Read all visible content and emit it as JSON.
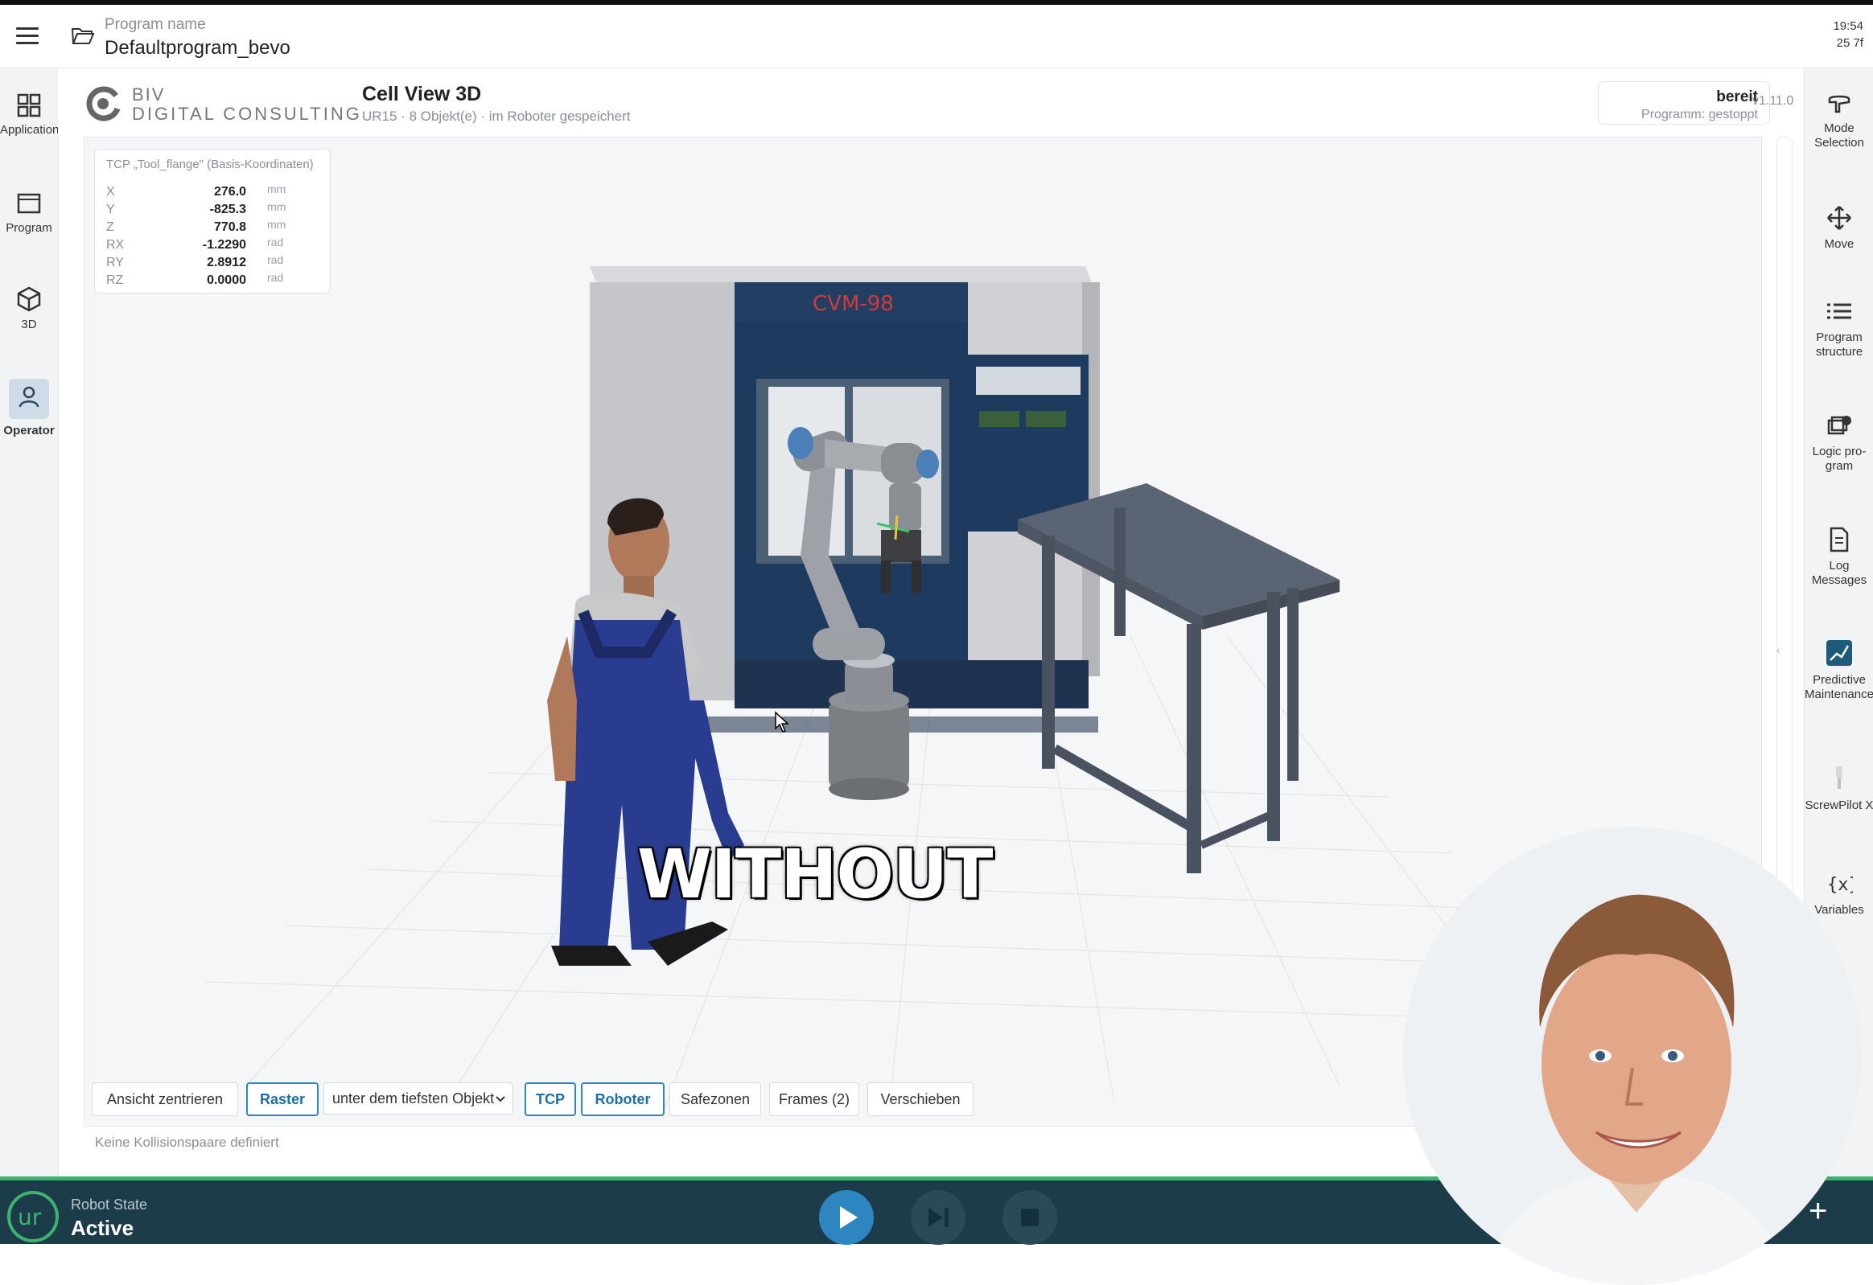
{
  "topbar": {
    "program_label": "Program name",
    "program_name": "Defaultprogram_bevo",
    "clock_line1": "19:54",
    "clock_line2": "25 7f"
  },
  "left_nav": {
    "items": [
      {
        "label": "Application",
        "icon": "grid-icon"
      },
      {
        "label": "Program",
        "icon": "window-icon"
      },
      {
        "label": "3D",
        "icon": "cube-icon"
      },
      {
        "label": "Operator",
        "icon": "person-icon",
        "active": true
      }
    ]
  },
  "header": {
    "logo_line1": "BIV",
    "logo_line2": "DIGITAL CONSULTING",
    "title": "Cell View 3D",
    "subtitle": "UR15 · 8 Objekt(e) · im Roboter gespeichert",
    "status": "bereit",
    "status_sub": "Programm: gestoppt",
    "version": "v1.11.0"
  },
  "tcp_panel": {
    "title": "TCP „Tool_flange\" (Basis-Koordinaten)",
    "rows": [
      {
        "key": "X",
        "value": "276.0",
        "unit": "mm"
      },
      {
        "key": "Y",
        "value": "-825.3",
        "unit": "mm"
      },
      {
        "key": "Z",
        "value": "770.8",
        "unit": "mm"
      },
      {
        "key": "RX",
        "value": "-1.2290",
        "unit": "rad"
      },
      {
        "key": "RY",
        "value": "2.8912",
        "unit": "rad"
      },
      {
        "key": "RZ",
        "value": "0.0000",
        "unit": "rad"
      }
    ]
  },
  "scene": {
    "machine_label": "CVM-98",
    "caption": "WITHOUT"
  },
  "toolbar": {
    "center_view": "Ansicht zentrieren",
    "grid": "Raster",
    "grid_position": "unter dem tiefsten Objekt",
    "tcp": "TCP",
    "robot": "Roboter",
    "safezones": "Safezonen",
    "frames": "Frames (2)",
    "move": "Verschieben"
  },
  "collision_text": "Keine Kollisionspaare definiert",
  "right_nav": {
    "items": [
      {
        "label": "Mode Selection",
        "icon": "hand-pointer-icon"
      },
      {
        "label": "Move",
        "icon": "move-arrows-icon"
      },
      {
        "label": "Program structure",
        "icon": "list-icon"
      },
      {
        "label": "Logic pro-gram",
        "icon": "logic-icon"
      },
      {
        "label": "Log Messages",
        "icon": "document-icon"
      },
      {
        "label": "Predictive Maintenance",
        "icon": "chart-icon"
      },
      {
        "label": "ScrewPilot X",
        "icon": "screwdriver-icon"
      },
      {
        "label": "Variables",
        "icon": "braces-icon"
      }
    ]
  },
  "bottom": {
    "robot_state_label": "Robot State",
    "robot_state_value": "Active"
  },
  "colors": {
    "accent": "#2e86c1",
    "bottom_bar": "#1c3c4a",
    "status_green": "#3cb371",
    "machine_blue": "#1e3a5f"
  }
}
